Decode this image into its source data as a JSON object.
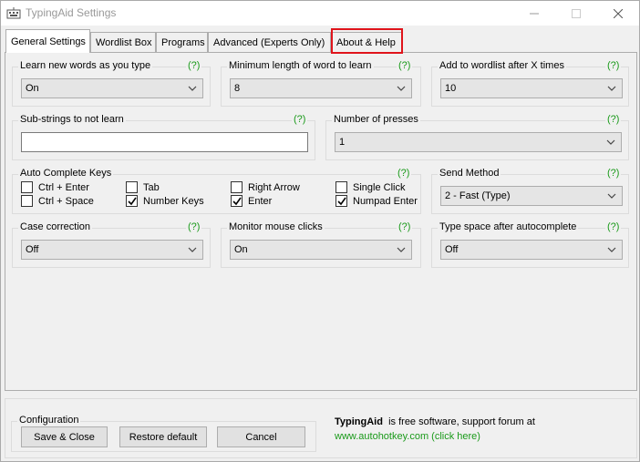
{
  "window": {
    "title": "TypingAid Settings",
    "icon": "keyboard-icon",
    "controls": [
      "minimize",
      "maximize",
      "close"
    ]
  },
  "tabs": [
    "General Settings",
    "Wordlist Box",
    "Programs",
    "Advanced (Experts Only)",
    "About & Help"
  ],
  "active_tab": "General Settings",
  "highlighted_tab": "About & Help",
  "help_label": "(?)",
  "groups": {
    "learn_new_words": {
      "label": "Learn new words as you type",
      "value": "On"
    },
    "min_length": {
      "label": "Minimum length of word to learn",
      "value": "8"
    },
    "add_after_times": {
      "label": "Add to wordlist after X times",
      "value": "10"
    },
    "substrings": {
      "label": "Sub-strings to not learn",
      "value": ""
    },
    "presses": {
      "label": "Number of presses",
      "value": "1"
    },
    "auto_complete": {
      "label": "Auto Complete Keys",
      "keys": [
        {
          "label": "Ctrl + Enter",
          "checked": false
        },
        {
          "label": "Tab",
          "checked": false
        },
        {
          "label": "Right Arrow",
          "checked": false
        },
        {
          "label": "Single Click",
          "checked": false
        },
        {
          "label": "Ctrl + Space",
          "checked": false
        },
        {
          "label": "Number Keys",
          "checked": true
        },
        {
          "label": "Enter",
          "checked": true
        },
        {
          "label": "Numpad Enter",
          "checked": true
        }
      ]
    },
    "send_method": {
      "label": "Send Method",
      "value": "2 - Fast (Type)"
    },
    "case_correction": {
      "label": "Case correction",
      "value": "Off"
    },
    "monitor_clicks": {
      "label": "Monitor mouse clicks",
      "value": "On"
    },
    "type_space": {
      "label": "Type space after autocomplete",
      "value": "Off"
    }
  },
  "configuration": {
    "label": "Configuration",
    "buttons": [
      "Save & Close",
      "Restore default",
      "Cancel"
    ]
  },
  "footer": {
    "app_name": "TypingAid",
    "text": "is free software, support forum at",
    "link": "www.autohotkey.com (click here)"
  },
  "colors": {
    "help": "#1a9a1a",
    "highlight": "#e0141b"
  }
}
